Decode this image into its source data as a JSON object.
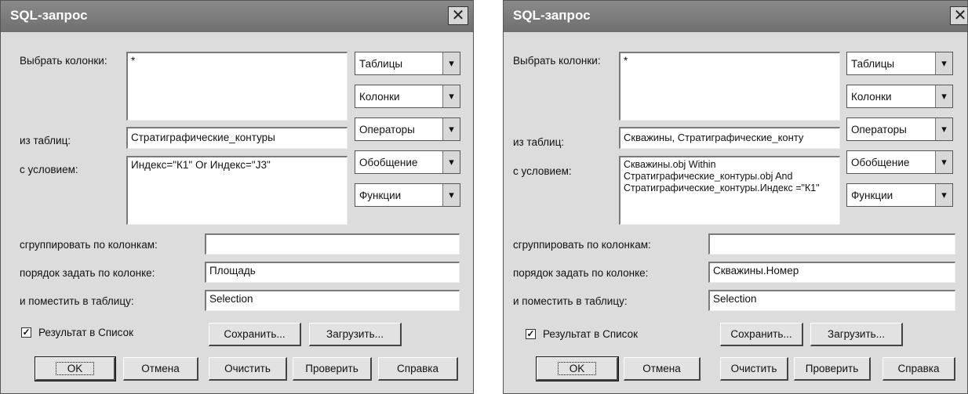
{
  "dialogs": [
    {
      "title": "SQL-запрос",
      "close_glyph": "✕",
      "labels": {
        "select_columns": "Выбрать колонки:",
        "from_tables": "из таблиц:",
        "with_condition": "с условием:",
        "group_by": "сгруппировать по колонкам:",
        "order_by": "порядок задать по колонке:",
        "into_table": "и поместить в таблицу:"
      },
      "fields": {
        "select_columns": "*",
        "from_tables": "Стратиграфические_контуры",
        "with_condition": "Индекс=\"К1\" Or Индекс=\"J3\"",
        "group_by": "",
        "order_by": "Площадь",
        "into_table": "Selection"
      },
      "combos": [
        "Таблицы",
        "Колонки",
        "Операторы",
        "Обобщение",
        "Функции"
      ],
      "combo_icon": "dropdown-arrow-icon",
      "checkbox": {
        "label": "Результат в Список",
        "checked": true,
        "mark": "✓"
      },
      "buttons": {
        "save": "Сохранить...",
        "load": "Загрузить...",
        "ok": "OK",
        "cancel": "Отмена",
        "clear": "Очистить",
        "verify": "Проверить",
        "help": "Справка"
      }
    },
    {
      "title": "SQL-запрос",
      "close_glyph": "✕",
      "labels": {
        "select_columns": "Выбрать колонки:",
        "from_tables": "из таблиц:",
        "with_condition": "с условием:",
        "group_by": "сгруппировать по колонкам:",
        "order_by": "порядок задать по колонке:",
        "into_table": "и поместить в таблицу:"
      },
      "fields": {
        "select_columns": "*",
        "from_tables": "Скважины, Стратиграфические_конту",
        "with_condition": "Скважины.obj Within Стратиграфические_контуры.obj And Стратиграфические_контуры.Индекс =\"К1\"",
        "group_by": "",
        "order_by": "Скважины.Номер",
        "into_table": "Selection"
      },
      "combos": [
        "Таблицы",
        "Колонки",
        "Операторы",
        "Обобщение",
        "Функции"
      ],
      "combo_icon": "dropdown-arrow-icon",
      "checkbox": {
        "label": "Результат в Список",
        "checked": true,
        "mark": "✓"
      },
      "buttons": {
        "save": "Сохранить...",
        "load": "Загрузить...",
        "ok": "OK",
        "cancel": "Отмена",
        "clear": "Очистить",
        "verify": "Проверить",
        "help": "Справка"
      }
    }
  ]
}
